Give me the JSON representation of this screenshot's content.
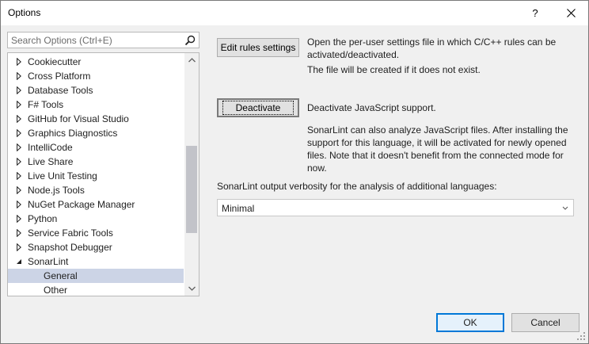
{
  "window": {
    "title": "Options",
    "help_glyph": "?",
    "close_glyph": "✕"
  },
  "search": {
    "placeholder": "Search Options (Ctrl+E)"
  },
  "tree": {
    "items": [
      {
        "label": "Cookiecutter",
        "expanded": false
      },
      {
        "label": "Cross Platform",
        "expanded": false
      },
      {
        "label": "Database Tools",
        "expanded": false
      },
      {
        "label": "F# Tools",
        "expanded": false
      },
      {
        "label": "GitHub for Visual Studio",
        "expanded": false
      },
      {
        "label": "Graphics Diagnostics",
        "expanded": false
      },
      {
        "label": "IntelliCode",
        "expanded": false
      },
      {
        "label": "Live Share",
        "expanded": false
      },
      {
        "label": "Live Unit Testing",
        "expanded": false
      },
      {
        "label": "Node.js Tools",
        "expanded": false
      },
      {
        "label": "NuGet Package Manager",
        "expanded": false
      },
      {
        "label": "Python",
        "expanded": false
      },
      {
        "label": "Service Fabric Tools",
        "expanded": false
      },
      {
        "label": "Snapshot Debugger",
        "expanded": false
      },
      {
        "label": "SonarLint",
        "expanded": true
      },
      {
        "label": "General",
        "child": true,
        "selected": true
      },
      {
        "label": "Other",
        "child": true
      }
    ],
    "scroll_position": 0.62
  },
  "panel": {
    "edit_rules_button": "Edit rules settings",
    "edit_rules_desc": "Open the per-user settings file in which C/C++ rules can be activated/deactivated.",
    "edit_rules_note": "The file will be created if it does not exist.",
    "deactivate_button": "Deactivate",
    "deactivate_desc": "Deactivate JavaScript support.",
    "js_info": "SonarLint can also analyze JavaScript files. After installing the support for this language, it will be activated for newly opened files. Note that it doesn't benefit from the connected mode for now.",
    "verbosity_label": "SonarLint output verbosity for the analysis of additional languages:",
    "verbosity_value": "Minimal"
  },
  "footer": {
    "ok_label": "OK",
    "cancel_label": "Cancel"
  },
  "colors": {
    "selection": "#ccd4e6",
    "default_button_border": "#0078d7"
  }
}
